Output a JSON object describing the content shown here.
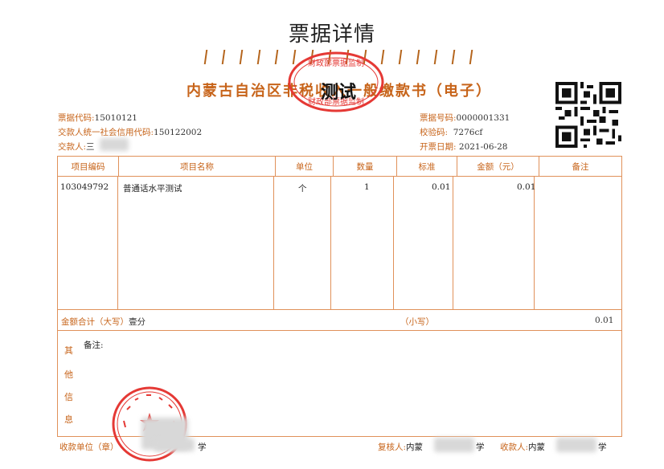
{
  "page_title": "票据详情",
  "doc_title": "内蒙古自治区非税收入一般缴款书（电子）",
  "watermark": "测试",
  "stamp_top_text": "财政部票据监制",
  "meta_left": [
    {
      "label": "票据代码:",
      "value": "15010121"
    },
    {
      "label": "交款人统一社会信用代码:",
      "value": "150122002"
    },
    {
      "label": "交款人:",
      "value": "三"
    }
  ],
  "meta_right": [
    {
      "label": "票据号码:",
      "value": "0000001331"
    },
    {
      "label": "校验码:",
      "value": "7276cf"
    },
    {
      "label": "开票日期:",
      "value": "2021-06-28"
    }
  ],
  "table": {
    "headers": [
      "项目编码",
      "项目名称",
      "单位",
      "数量",
      "标准",
      "金额（元）",
      "备注"
    ],
    "rows": [
      {
        "code": "103049792",
        "name": "普通话水平测试",
        "unit": "个",
        "qty": "1",
        "std": "0.01",
        "amount": "0.01",
        "note": ""
      }
    ]
  },
  "total": {
    "label_big": "金额合计（大写）",
    "value_big": "壹分",
    "label_small": "（小写）",
    "value_small": "0.01"
  },
  "other_info": {
    "side_label": [
      "其",
      "他",
      "信",
      "息"
    ],
    "note_label": "备注:"
  },
  "footer": {
    "payee_unit_label": "收款单位（章）",
    "payee_unit_suffix": "学",
    "reviewer_label": "复核人:",
    "reviewer_value": "内蒙",
    "reviewer_suffix": "学",
    "cashier_label": "收款人:",
    "cashier_value": "内蒙",
    "cashier_suffix": "学"
  },
  "colors": {
    "accent": "#c7641a",
    "stamp": "#e53935",
    "line": "#e0915a"
  }
}
